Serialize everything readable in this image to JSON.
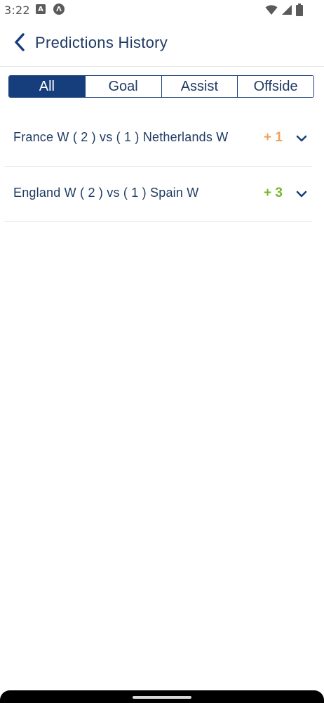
{
  "status_bar": {
    "time": "3:22",
    "icons": [
      "app-a-icon",
      "app-lambda-icon",
      "wifi-icon",
      "signal-icon",
      "battery-icon"
    ]
  },
  "header": {
    "back_icon": "chevron-left-icon",
    "title": "Predictions History"
  },
  "tabs": [
    {
      "label": "All",
      "active": true
    },
    {
      "label": "Goal",
      "active": false
    },
    {
      "label": "Assist",
      "active": false
    },
    {
      "label": "Offside",
      "active": false
    }
  ],
  "predictions": [
    {
      "match": "France W ( 2 ) vs ( 1 ) Netherlands W",
      "points": "+ 1",
      "points_color": "#f0a05a"
    },
    {
      "match": "England W ( 2 ) vs ( 1 ) Spain W",
      "points": "+ 3",
      "points_color": "#76b72a"
    }
  ],
  "colors": {
    "primary": "#173e7c",
    "text": "#1f3b63",
    "orange": "#f0a05a",
    "green": "#76b72a"
  }
}
